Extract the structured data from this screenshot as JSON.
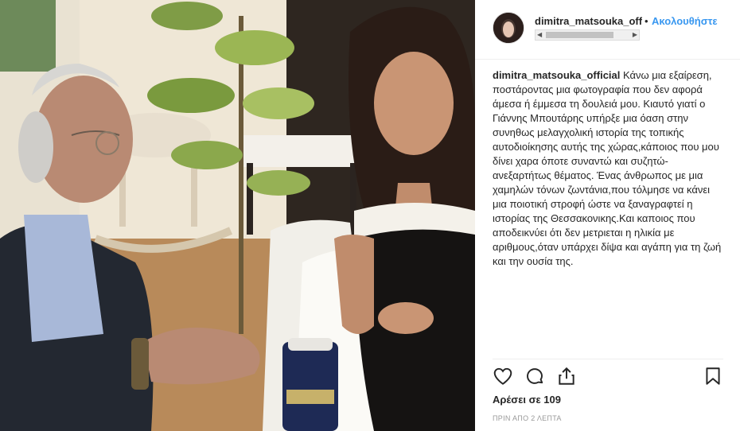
{
  "post": {
    "username": "dimitra_matsouka_official",
    "header_username": "dimitra_matsouka_official",
    "dot": "•",
    "follow_label": "Ακολουθήστε",
    "caption": "Κάνω μια εξαίρεση, ποστάροντας μια φωτογραφία που δεν αφορά άμεσα ή έμμεσα τη δουλειά μου. Κιαυτό γιατί ο Γιάννης Μπουτάρης υπήρξε μια όαση στην συνηθως μελαγχολική ιστορία της τοπικής αυτοδιοίκησης αυτής της χώρας,κάποιος που μου δίνει χαρα όποτε συναντώ και συζητώ-ανεξαρτήτως θέματος. Ένας άνθρωπος με μια χαμηλών τόνων ζωντάνια,που τόλμησε να κάνει μια ποιοτική στροφή ώστε να ξαναγραφτεί η ιστορίας της Θεσσακονικης.Και καποιος που αποδεικνύει ότι δεν μετριεται η ηλικία με αριθμους,όταν υπάρχει δίψα και αγάπη για τη ζωή και την ουσία της.",
    "likes": "Αρέσει σε 109",
    "time": "ΠΡΙΝ ΑΠΟ 2 ΛΕΠΤΑ"
  },
  "icons": {
    "like": "heart-icon",
    "comment": "comment-icon",
    "share": "share-icon",
    "save": "bookmark-icon"
  },
  "colors": {
    "follow": "#3897f0",
    "text": "#262626",
    "muted": "#999999",
    "divider": "#efefef"
  }
}
